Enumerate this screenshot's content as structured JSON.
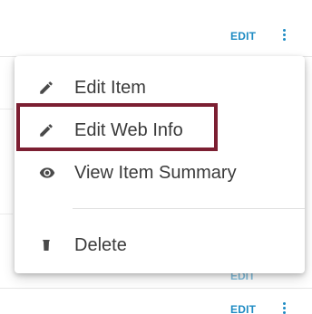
{
  "rows": [
    {
      "edit_label": "EDIT"
    },
    {
      "edit_label": "EDIT"
    },
    {
      "edit_label": "EDIT"
    }
  ],
  "menu": {
    "items": [
      {
        "label": "Edit Item",
        "icon": "pencil-icon"
      },
      {
        "label": "Edit Web Info",
        "icon": "pencil-icon"
      },
      {
        "label": "View Item Summary",
        "icon": "eye-icon"
      },
      {
        "label": "Delete",
        "icon": "trash-icon"
      }
    ]
  },
  "colors": {
    "accent": "#1e8bc3",
    "highlight": "#7c1f32",
    "icon": "#4a4a4a",
    "text": "#3a3a3a"
  }
}
